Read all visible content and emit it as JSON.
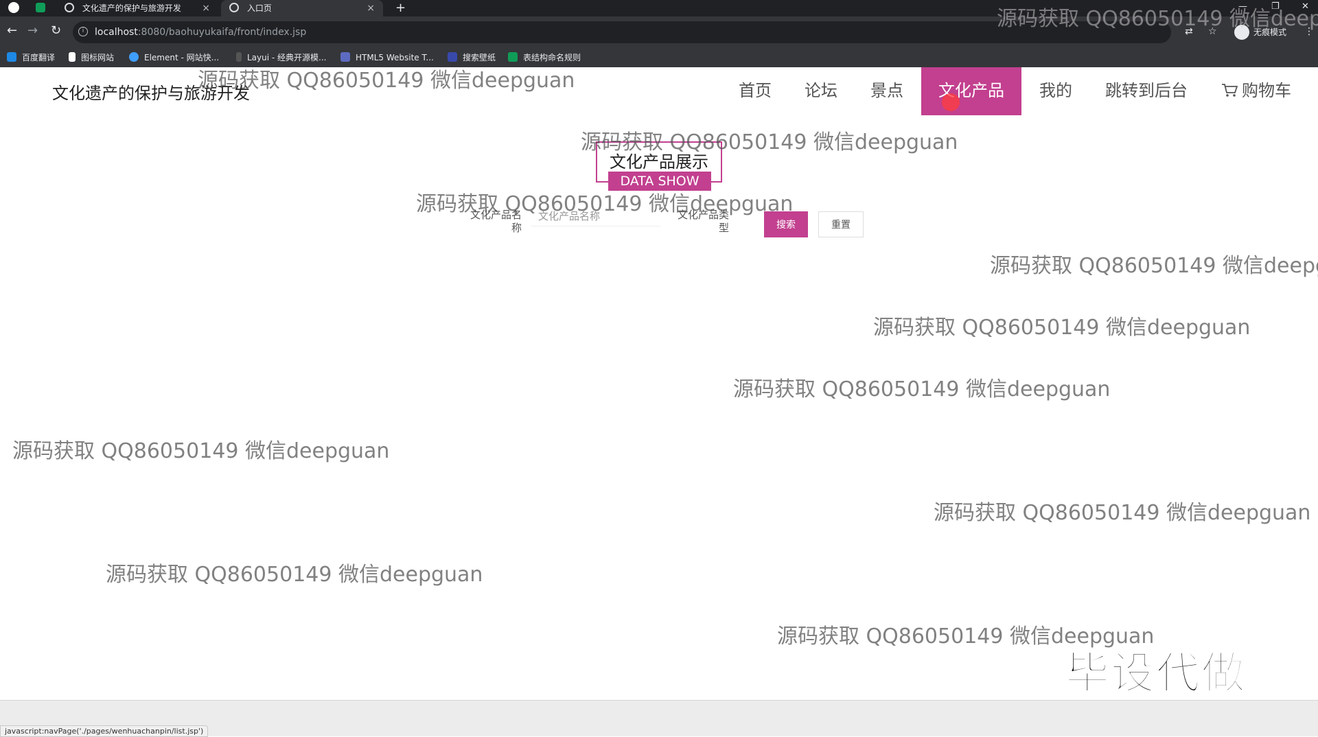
{
  "browser": {
    "tabs": [
      {
        "title": "文化遗产的保护与旅游开发",
        "active": false
      },
      {
        "title": "入口页",
        "active": true
      }
    ],
    "new_tab_symbol": "+",
    "close_symbol": "×",
    "url_host": "localhost",
    "url_path": ":8080/baohuyukaifa/front/index.jsp",
    "incognito_label": "无痕模式",
    "bookmarks": [
      {
        "label": "百度翻译",
        "icon": "baidu-translate-icon",
        "color": "#1e88e5"
      },
      {
        "label": "图标网站",
        "icon": "flag-icon",
        "color": "#ffffff"
      },
      {
        "label": "Element - 网站快...",
        "icon": "element-icon",
        "color": "#409eff"
      },
      {
        "label": "Layui - 经典开源模...",
        "icon": "layui-icon",
        "color": "#cccccc"
      },
      {
        "label": "HTML5 Website T...",
        "icon": "html5-icon",
        "color": "#5c6bc0"
      },
      {
        "label": "搜索壁纸",
        "icon": "wallpaper-icon",
        "color": "#3949ab"
      },
      {
        "label": "表结构命名规则",
        "icon": "sheet-icon",
        "color": "#0f9d58"
      }
    ]
  },
  "site": {
    "title": "文化遗产的保护与旅游开发",
    "nav": [
      {
        "label": "首页",
        "active": false
      },
      {
        "label": "论坛",
        "active": false
      },
      {
        "label": "景点",
        "active": false
      },
      {
        "label": "文化产品",
        "active": true
      },
      {
        "label": "我的",
        "active": false
      },
      {
        "label": "跳转到后台",
        "active": false
      },
      {
        "label": "购物车",
        "active": false,
        "icon": "cart-icon"
      }
    ],
    "accent_color": "#c2408f"
  },
  "section": {
    "title_cn": "文化产品展示",
    "title_en": "DATA SHOW"
  },
  "search": {
    "name_label_line1": "文化产品名",
    "name_label_line2": "称",
    "name_placeholder": "文化产品名称",
    "type_label_line1": "文化产品类",
    "type_label_line2": "型",
    "type_value": "",
    "search_button": "搜索",
    "reset_button": "重置"
  },
  "watermark_text": "源码获取 QQ86050149 微信deepguan",
  "watermark_partial": "源码获取 QQ86050149 微信deep",
  "promo_text": "毕设代做",
  "status_bar_text": "javascript:navPage('./pages/wenhuachanpin/list.jsp')"
}
